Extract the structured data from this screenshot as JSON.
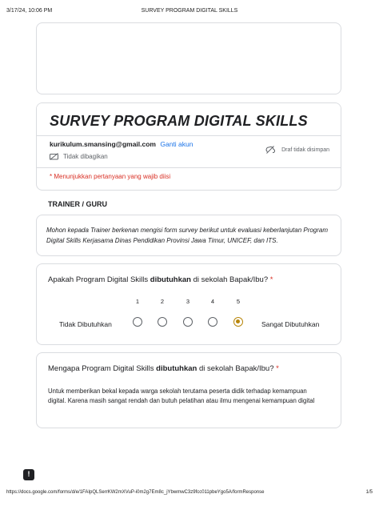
{
  "print_header": {
    "datetime": "3/17/24, 10:06 PM",
    "title": "SURVEY PROGRAM DIGITAL SKILLS"
  },
  "print_footer": {
    "url": "https://docs.google.com/forms/d/e/1FAIpQLSerrKW2mXVuP-i0m2g7Em8c_jYbwmwC3z9fcc011pbeYgo5A/formResponse",
    "page": "1/5"
  },
  "form": {
    "title": "SURVEY PROGRAM DIGITAL SKILLS",
    "account_email": "kurikulum.smansing@gmail.com",
    "switch_account_label": "Ganti akun",
    "not_shared_label": "Tidak dibagikan",
    "draft_status": "Draf tidak disimpan",
    "required_note": "* Menunjukkan pertanyaan yang wajib diisi"
  },
  "section": {
    "title": "TRAINER / GURU",
    "description": "Mohon kepada Trainer berkenan mengisi form survey berikut untuk evaluasi keberlanjutan Program Digital Skills Kerjasama Dinas Pendidikan Provinsi Jawa Timur, UNICEF, dan ITS."
  },
  "question1": {
    "prefix": "Apakah Program Digital Skills ",
    "bold": "dibutuhkan",
    "suffix": " di sekolah Bapak/Ibu? ",
    "required_mark": "*",
    "scale": [
      "1",
      "2",
      "3",
      "4",
      "5"
    ],
    "selected_value": 5,
    "label_low": "Tidak Dibutuhkan",
    "label_high": "Sangat Dibutuhkan"
  },
  "question2": {
    "prefix": "Mengapa Program Digital Skills ",
    "bold": "dibutuhkan",
    "suffix": " di sekolah Bapak/Ibu? ",
    "required_mark": "*",
    "answer": "Untuk memberikan bekal kepada warga sekolah terutama peserta didik terhadap kemampuan digital. Karena masih sangat rendah dan butuh pelatihan atau ilmu mengenai kemampuan digital"
  },
  "colors": {
    "accent_selected": "#b8860b",
    "required": "#d93025",
    "link": "#1a73e8"
  },
  "icons": {
    "not_shared": "eye-slash-icon",
    "draft": "cloud-sync-off-icon",
    "feedback": "feedback-icon"
  }
}
